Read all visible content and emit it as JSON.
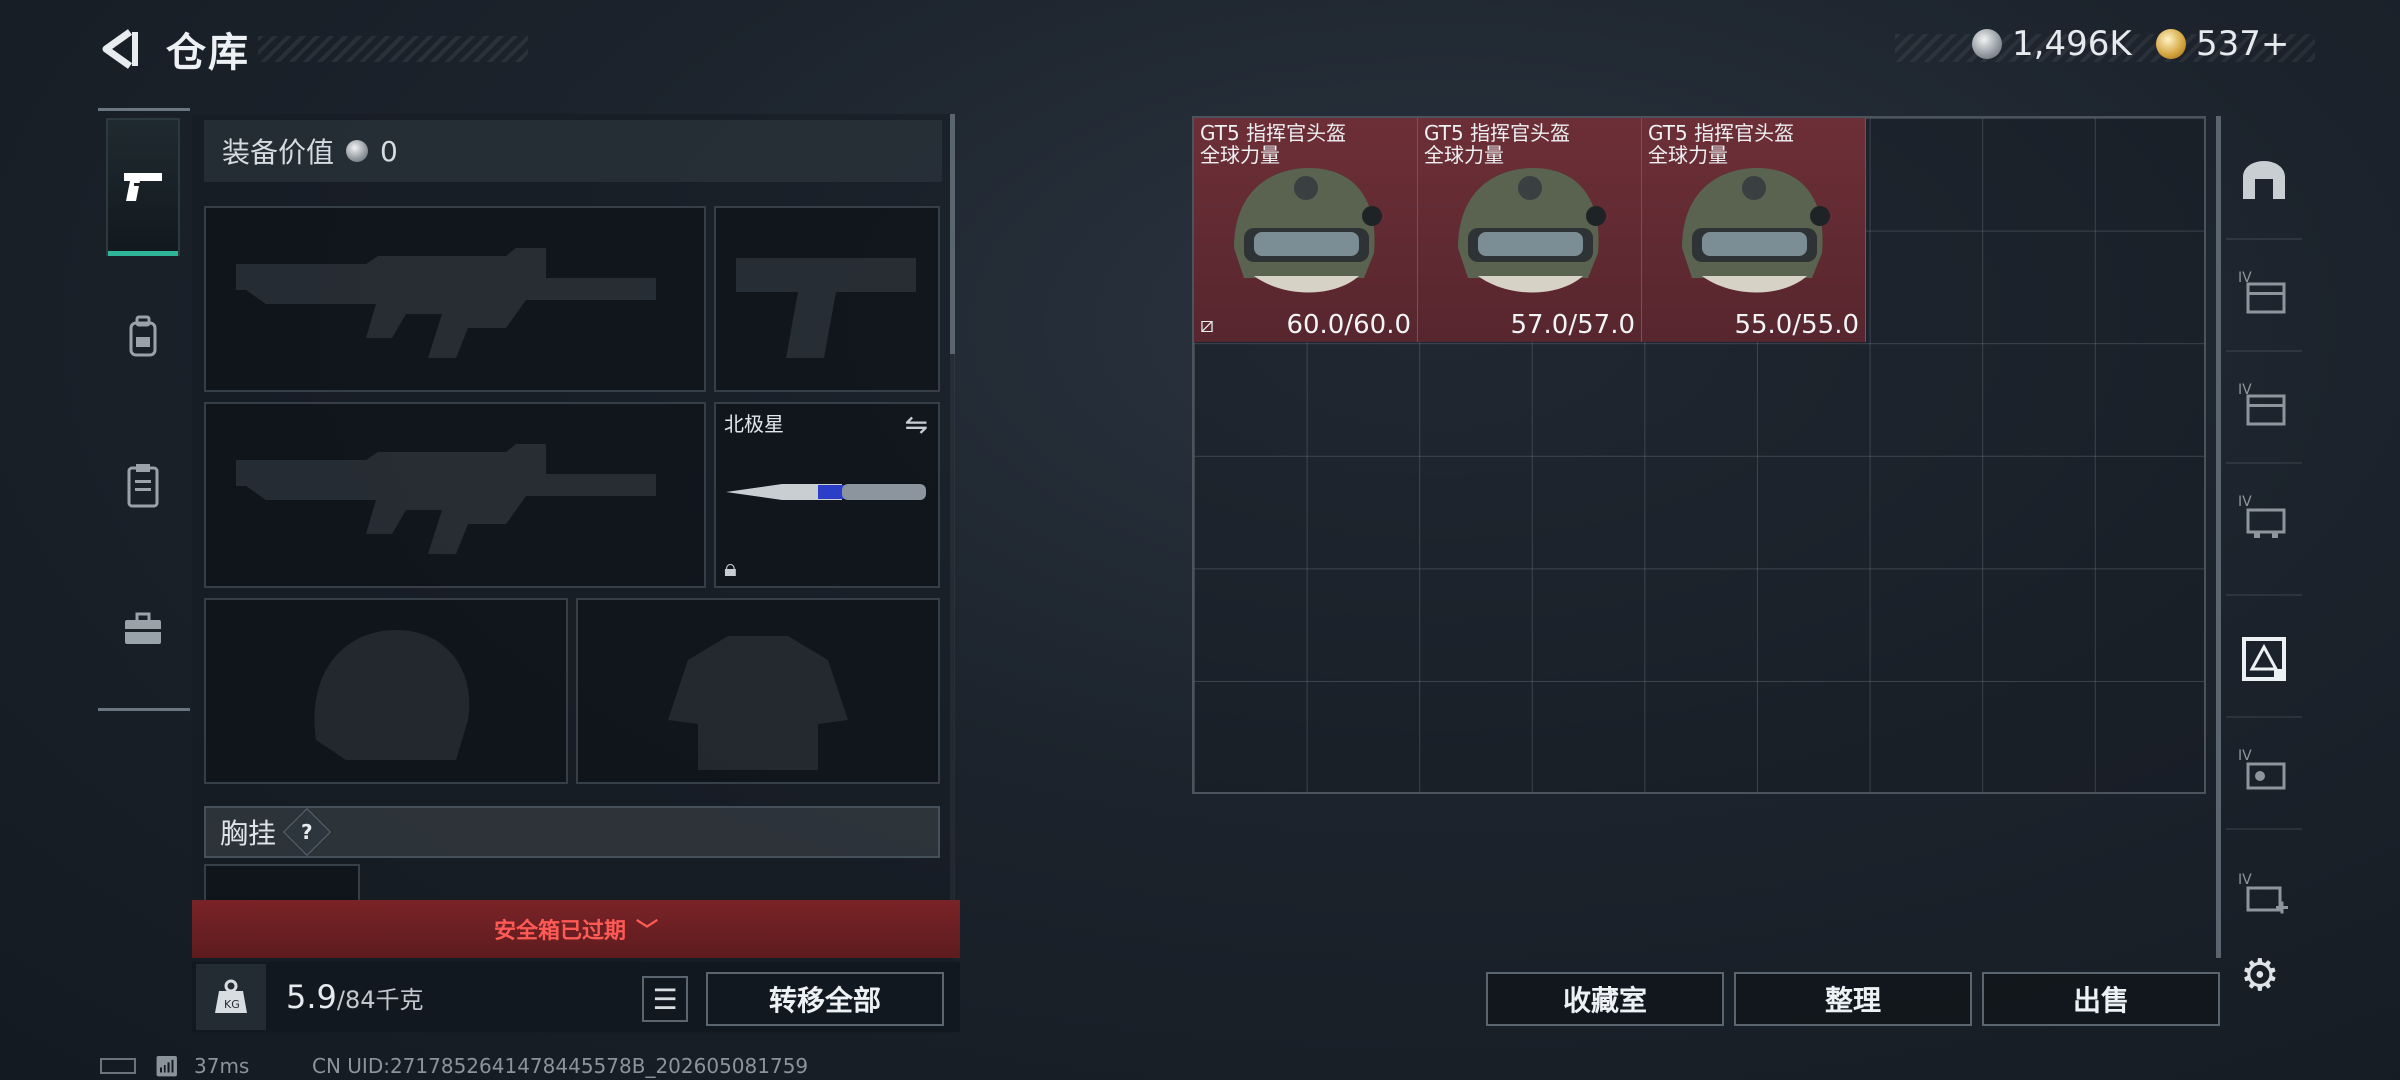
{
  "header": {
    "title": "仓库",
    "currencies": [
      {
        "icon": "silver-coin-icon",
        "value": "1,496K"
      },
      {
        "icon": "gold-coin-icon",
        "value": "537+"
      }
    ]
  },
  "categories": [
    {
      "name": "weapons",
      "icon": "pistol-icon",
      "active": true
    },
    {
      "name": "gear",
      "icon": "backpack-icon",
      "active": false
    },
    {
      "name": "vest",
      "icon": "clipboard-icon",
      "active": false
    },
    {
      "name": "case",
      "icon": "briefcase-icon",
      "active": false
    }
  ],
  "equipment": {
    "value_label": "装备价值",
    "value": "0",
    "melee_label": "北极星",
    "chest_label": "胸挂",
    "chest_help": "?",
    "expired_text": "安全箱已过期",
    "weight_value": "5.9",
    "weight_max": "/84千克",
    "transfer_all": "转移全部"
  },
  "storage": {
    "items": [
      {
        "name_line1": "GT5 指挥官头盔",
        "name_line2": "全球力量",
        "durability": "60.0/60.0",
        "flag": true
      },
      {
        "name_line1": "GT5 指挥官头盔",
        "name_line2": "全球力量",
        "durability": "57.0/57.0",
        "flag": false
      },
      {
        "name_line1": "GT5 指挥官头盔",
        "name_line2": "全球力量",
        "durability": "55.0/55.0",
        "flag": false
      }
    ],
    "side_tabs": [
      {
        "icon": "safehouse-icon",
        "label": ""
      },
      {
        "icon": "storage-box-icon",
        "label": "IV"
      },
      {
        "icon": "storage-box-icon",
        "label": "IV"
      },
      {
        "icon": "storage-box-icon",
        "label": "IV"
      },
      {
        "icon": "rarity-box-icon",
        "label": ""
      },
      {
        "icon": "storage-box-icon",
        "label": "IV"
      },
      {
        "icon": "add-storage-icon",
        "label": "IV"
      }
    ],
    "buttons": {
      "collection": "收藏室",
      "organize": "整理",
      "sell": "出售"
    }
  },
  "status": {
    "ping": "37ms",
    "uid": "CN UID:2717852641478445578B_202605081759"
  }
}
